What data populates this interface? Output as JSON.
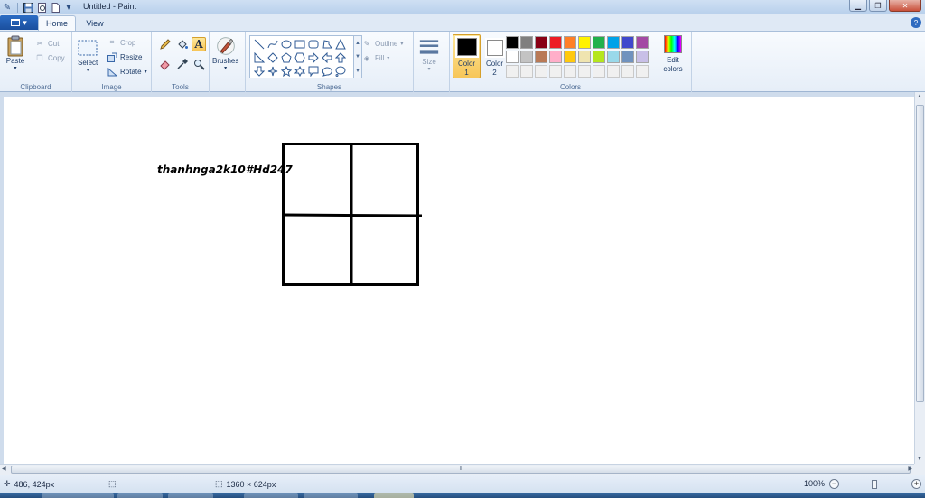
{
  "window": {
    "title": "Untitled - Paint"
  },
  "tabs": [
    {
      "label": "Home"
    },
    {
      "label": "View"
    }
  ],
  "ribbon": {
    "clipboard": {
      "group_label": "Clipboard",
      "paste": "Paste",
      "cut": "Cut",
      "copy": "Copy"
    },
    "image": {
      "group_label": "Image",
      "select": "Select",
      "crop": "Crop",
      "resize": "Resize",
      "rotate": "Rotate"
    },
    "tools": {
      "group_label": "Tools"
    },
    "brushes": {
      "label": "Brushes"
    },
    "shapes": {
      "group_label": "Shapes",
      "outline": "Outline",
      "fill": "Fill"
    },
    "size": {
      "label": "Size"
    },
    "colors": {
      "group_label": "Colors",
      "color1_line1": "Color",
      "color1_line2": "1",
      "color2_line1": "Color",
      "color2_line2": "2",
      "edit_line1": "Edit",
      "edit_line2": "colors",
      "color1_value": "#000000",
      "color2_value": "#ffffff",
      "palette": [
        "#000000",
        "#7f7f7f",
        "#880015",
        "#ed1c24",
        "#ff7f27",
        "#fff200",
        "#22b14c",
        "#00a2e8",
        "#3f48cc",
        "#a349a4",
        "#ffffff",
        "#c3c3c3",
        "#b97a57",
        "#ffaec9",
        "#ffc90e",
        "#efe4b0",
        "#b5e61d",
        "#99d9ea",
        "#7092be",
        "#c8bfe7",
        "#f0f0f0",
        "#f0f0f0",
        "#f0f0f0",
        "#f0f0f0",
        "#f0f0f0",
        "#f0f0f0",
        "#f0f0f0",
        "#f0f0f0",
        "#f0f0f0",
        "#f0f0f0"
      ]
    }
  },
  "canvas": {
    "text": "thanhnga2k10#Hd247"
  },
  "status": {
    "cursor_position": "486, 424px",
    "image_size": "1360 × 624px",
    "zoom": "100%"
  }
}
